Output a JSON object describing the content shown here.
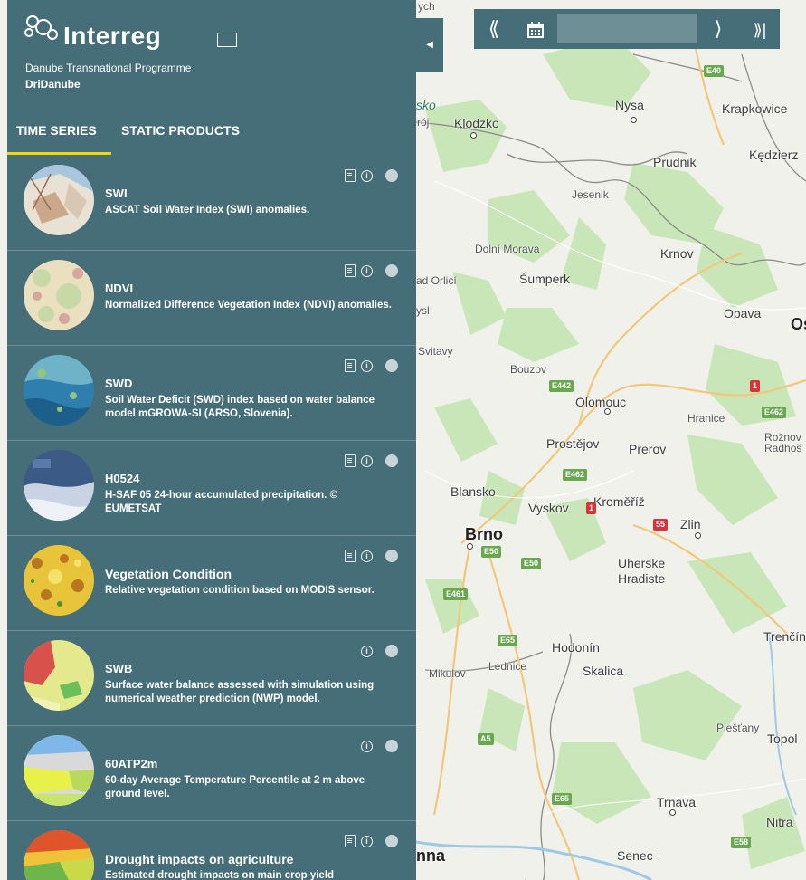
{
  "panel": {
    "logo_text": "Interreg",
    "logo_sub": "Danube Transnational Programme",
    "project": "DriDanube",
    "tabs": [
      {
        "label": "TIME SERIES",
        "active": true
      },
      {
        "label": "STATIC PRODUCTS",
        "active": false
      }
    ],
    "items": [
      {
        "title": "SWI",
        "desc": "ASCAT Soil Water Index (SWI) anomalies.",
        "has_doc": true
      },
      {
        "title": "NDVI",
        "desc": "Normalized Difference Vegetation Index (NDVI) anomalies.",
        "has_doc": true
      },
      {
        "title": "SWD",
        "desc": "Soil Water Deficit (SWD) index based on water balance model mGROWA-SI (ARSO, Slovenia).",
        "has_doc": true
      },
      {
        "title": "H0524",
        "desc": "H-SAF 05 24-hour accumulated precipitation. © EUMETSAT",
        "has_doc": true
      },
      {
        "title": "Vegetation Condition",
        "desc": "Relative vegetation condition based on MODIS sensor.",
        "has_doc": true
      },
      {
        "title": "SWB",
        "desc": "Surface water balance assessed with simulation using numerical weather prediction (NWP) model.",
        "has_doc": false
      },
      {
        "title": "60ATP2m",
        "desc": "60-day Average Temperature Percentile at 2 m above ground level.",
        "has_doc": false
      },
      {
        "title": "Drought impacts on agriculture",
        "desc": "Estimated drought impacts on main crop yield",
        "has_doc": true
      }
    ]
  },
  "timebar": {
    "prev_icon": "double-chevron-left-icon",
    "calendar_icon": "calendar-icon",
    "date_value": "",
    "next_icon": "chevron-right-icon",
    "last_icon": "skip-to-end-icon"
  },
  "map": {
    "cities": [
      "Nysa",
      "Krapkowice",
      "Klodzko",
      "Prudnik",
      "Kędzierz",
      "Jesenik",
      "Dolní Morava",
      "Krnov",
      "Šumperk",
      "ad Orlicí",
      "Opava",
      "Os",
      "Svitavy",
      "Bouzov",
      "Olomouc",
      "Hranice",
      "Rožnov Radhoš",
      "Prostějov",
      "Prerov",
      "Blansko",
      "Vyskov",
      "Kroměříž",
      "Zlin",
      "Brno",
      "Uherske Hradiste",
      "Trenčín",
      "Hodonín",
      "Lednice",
      "Mikulov",
      "Skalica",
      "Piešťany",
      "Topol",
      "Trnava",
      "Nitra",
      "Senec",
      "nna",
      "rój",
      "sko",
      "ysl",
      "ych"
    ],
    "roads": [
      "E40",
      "E442",
      "E462",
      "E462",
      "1",
      "1",
      "55",
      "E50",
      "E50",
      "E461",
      "E65",
      "A5",
      "E65",
      "E58"
    ]
  },
  "colors": {
    "panel": "#466e78",
    "tab_underline": "#f2d700",
    "map_bg": "#f1f1ec",
    "forest": "#c5e3b5"
  }
}
